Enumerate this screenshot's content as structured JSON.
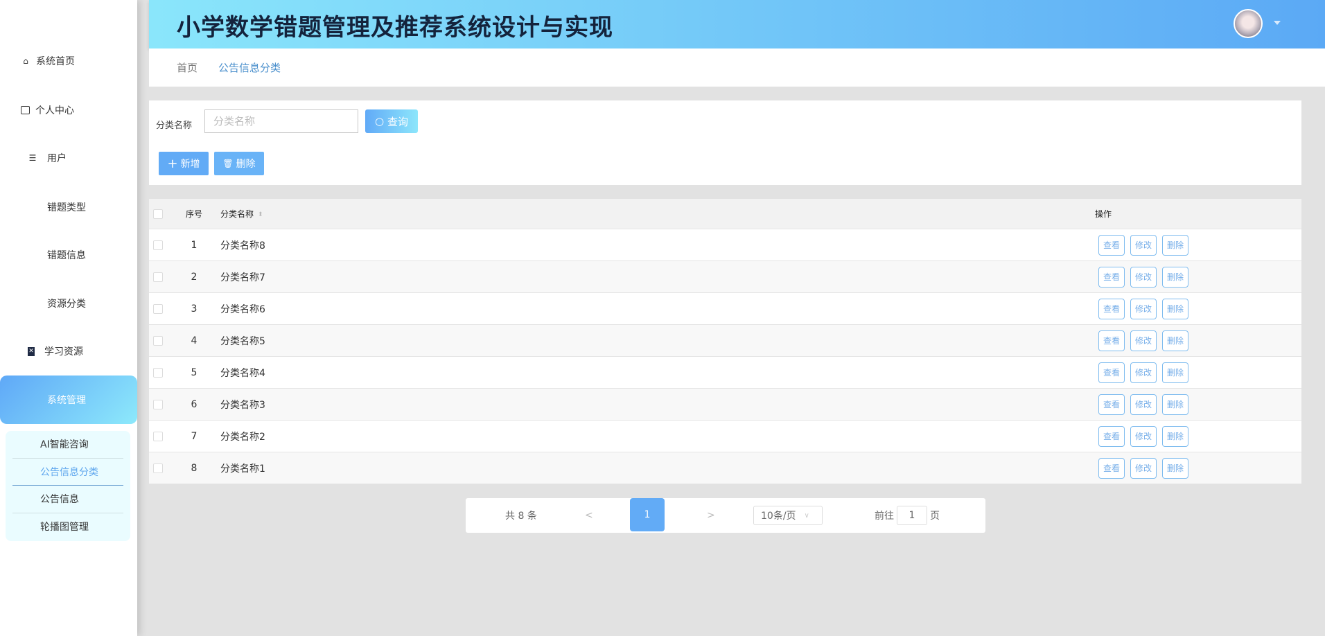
{
  "app": {
    "title": "小学数学错题管理及推荐系统设计与实现"
  },
  "sidebar": {
    "items": [
      {
        "label": "系统首页",
        "icon": "home-icon"
      },
      {
        "label": "个人中心",
        "icon": "wallet-icon"
      },
      {
        "label": "用户",
        "icon": "list-icon"
      },
      {
        "label": "错题类型",
        "icon": "grid-icon"
      },
      {
        "label": "错题信息",
        "icon": "grid-icon"
      },
      {
        "label": "资源分类",
        "icon": "grid-icon"
      },
      {
        "label": "学习资源",
        "icon": "clipboard-icon"
      },
      {
        "label": "系统管理",
        "icon": "grid-icon"
      }
    ],
    "submenu": [
      "AI智能咨询",
      "公告信息分类",
      "公告信息",
      "轮播图管理"
    ]
  },
  "breadcrumb": [
    "首页",
    "公告信息分类"
  ],
  "search": {
    "label": "分类名称",
    "placeholder": "分类名称",
    "query_label": "查询",
    "add_label": "新增",
    "delete_label": "删除"
  },
  "table": {
    "headers": {
      "index": "序号",
      "name": "分类名称",
      "actions": "操作"
    },
    "rows": [
      {
        "i": "1",
        "n": "分类名称8"
      },
      {
        "i": "2",
        "n": "分类名称7"
      },
      {
        "i": "3",
        "n": "分类名称6"
      },
      {
        "i": "4",
        "n": "分类名称5"
      },
      {
        "i": "5",
        "n": "分类名称4"
      },
      {
        "i": "6",
        "n": "分类名称3"
      },
      {
        "i": "7",
        "n": "分类名称2"
      },
      {
        "i": "8",
        "n": "分类名称1"
      }
    ],
    "actions": [
      "查看",
      "修改",
      "删除"
    ]
  },
  "pagination": {
    "total": "共 8 条",
    "prev": "<",
    "current": "1",
    "next": ">",
    "page_size": "10条/页",
    "goto_prefix": "前往",
    "goto_value": "1",
    "goto_suffix": "页"
  },
  "colors": {
    "accent": "#62abf6",
    "header_start": "#8ae6fb",
    "header_end": "#5ba9f5"
  }
}
